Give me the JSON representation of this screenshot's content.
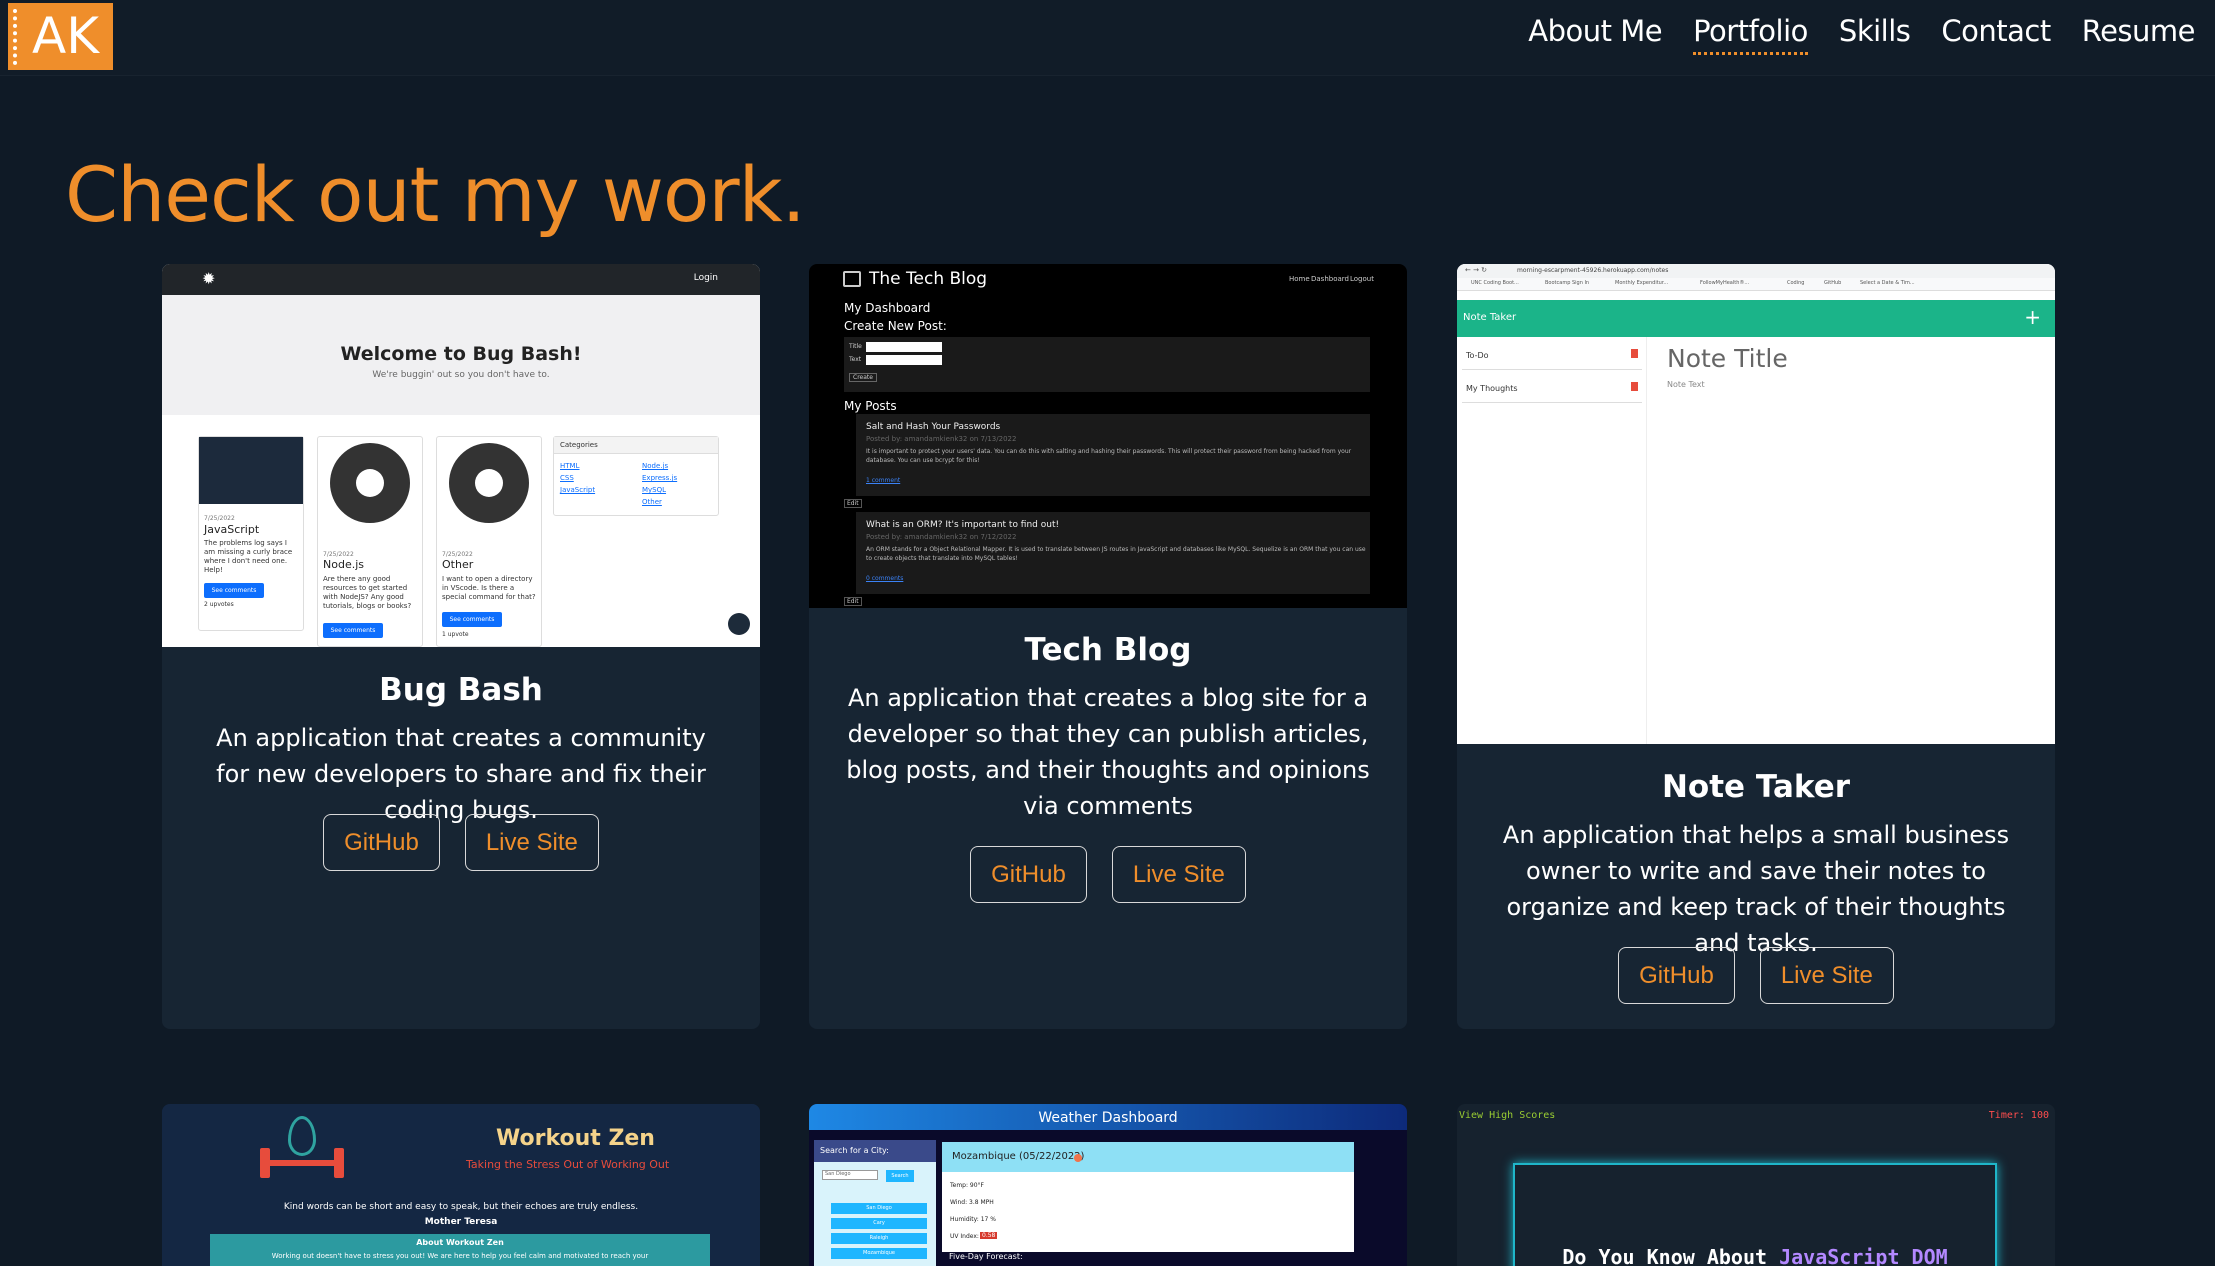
{
  "header": {
    "logo_text": "AK",
    "nav": [
      "About Me",
      "Portfolio",
      "Skills",
      "Contact",
      "Resume"
    ],
    "active": "Portfolio"
  },
  "heading": "Check out my work.",
  "colors": {
    "accent": "#ef8e2b",
    "background": "#0f1a26",
    "card": "#172533"
  },
  "cards": [
    {
      "title": "Bug Bash",
      "description": "An application that creates a community for new developers to share and fix their coding bugs.",
      "github": "GitHub",
      "live": "Live Site",
      "preview": {
        "login": "Login",
        "welcome": "Welcome to Bug Bash!",
        "tagline": "We're buggin' out so you don't have to.",
        "posts": [
          {
            "date": "7/25/2022",
            "name": "JavaScript",
            "text": "The problems log says I am missing a curly brace where I don't need one. Help!",
            "button": "See comments",
            "votes": "2 upvotes"
          },
          {
            "date": "7/25/2022",
            "name": "Node.js",
            "text": "Are there any good resources to get started with NodeJS? Any good tutorials, blogs or books?",
            "button": "See comments",
            "votes": ""
          },
          {
            "date": "7/25/2022",
            "name": "Other",
            "text": "I want to open a directory in VScode. Is there a special command for that?",
            "button": "See comments",
            "votes": "1 upvote"
          }
        ],
        "categories_title": "Categories",
        "categories": [
          "HTML",
          "CSS",
          "JavaScript",
          "Node.js",
          "Express.js",
          "MySQL",
          "Other"
        ]
      }
    },
    {
      "title": "Tech Blog",
      "description": "An application that creates a blog site for a developer so that they can publish articles, blog posts, and their thoughts and opinions via comments",
      "github": "GitHub",
      "live": "Live Site",
      "preview": {
        "brand": "The Tech Blog",
        "links": [
          "Home",
          "Dashboard",
          "Logout"
        ],
        "dashboard": "My Dashboard",
        "create": "Create New Post:",
        "field_title": "Title",
        "field_text": "Text",
        "create_btn": "Create",
        "my_posts": "My Posts",
        "posts": [
          {
            "title": "Salt and Hash Your Passwords",
            "meta": "Posted by: amandamkienk32 on 7/13/2022",
            "body": "It is important to protect your users' data. You can do this with salting and hashing their passwords. This will protect their password from being hacked from your database. You can use bcrypt for this!",
            "comments": "1 comment",
            "edit": "Edit"
          },
          {
            "title": "What is an ORM? It's important to find out!",
            "meta": "Posted by: amandamkienk32 on 7/12/2022",
            "body": "An ORM stands for a Object Relational Mapper. It is used to translate between JS routes in JavaScript and databases like MySQL. Sequelize is an ORM that you can use to create objects that translate into MySQL tables!",
            "comments": "0 comments",
            "edit": "Edit"
          }
        ]
      }
    },
    {
      "title": "Note Taker",
      "description": "An application that helps a small business owner to write and save their notes to organize and keep track of their thoughts and tasks.",
      "github": "GitHub",
      "live": "Live Site",
      "preview": {
        "url": "morning-escarpment-45926.herokuapp.com/notes",
        "bookmarks": [
          "UNC Coding Boot...",
          "Bootcamp Sign In",
          "Monthly Expenditur...",
          "FollowMyHealth®...",
          "Coding",
          "GitHub",
          "Select a Date & Tim..."
        ],
        "app": "Note Taker",
        "notes": [
          "To-Do",
          "My Thoughts"
        ],
        "note_title": "Note Title",
        "note_text": "Note Text"
      }
    },
    {
      "preview": {
        "title": "Workout Zen",
        "subtitle": "Taking the Stress Out of Working Out",
        "quote": "Kind words can be short and easy to speak, but their echoes are truly endless.",
        "author": "Mother Teresa",
        "about_title": "About Workout Zen",
        "about": "Working out doesn't have to stress you out! We are here to help you feel calm and motivated to reach your"
      }
    },
    {
      "preview": {
        "title": "Weather Dashboard",
        "search_label": "Search for a City:",
        "search_placeholder": "San Diego",
        "search_btn": "Search",
        "cities": [
          "San Diego",
          "Cary",
          "Raleigh",
          "Mozambique"
        ],
        "city": "Mozambique (05/22/2022)",
        "temp": "Temp: 90°F",
        "wind": "Wind: 3.8 MPH",
        "humidity": "Humidity: 17 %",
        "uv": "UV Index:",
        "uv_value": "0.58",
        "forecast": "Five-Day Forecast:"
      }
    },
    {
      "preview": {
        "high_scores": "View High Scores",
        "timer": "Timer: 100",
        "question_start": "Do You Know About",
        "question_highlight": "JavaScript DOM"
      }
    }
  ]
}
